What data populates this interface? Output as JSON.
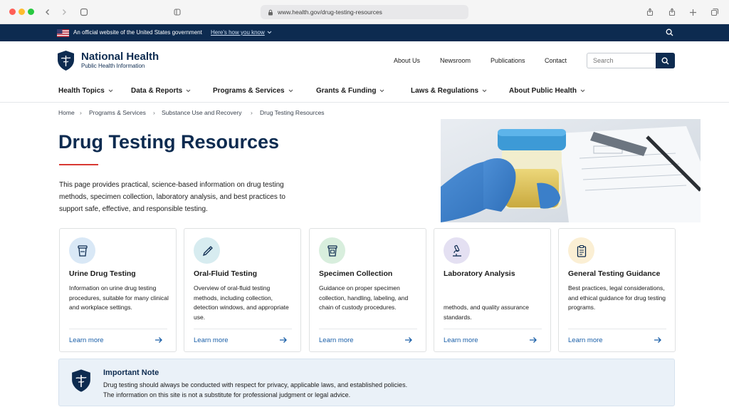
{
  "browser": {
    "url": "www.health.gov/drug-testing-resources"
  },
  "gov_banner": {
    "official_text": "An official website of the United States government",
    "how_you_know": "Here's how you know"
  },
  "header": {
    "site_name": "National Health",
    "site_tagline": "Public Health Information",
    "utility_nav": [
      "About Us",
      "Newsroom",
      "Publications",
      "Contact"
    ],
    "search_placeholder": "Search"
  },
  "main_nav": [
    "Health Topics",
    "Data & Reports",
    "Programs & Services",
    "Grants & Funding",
    "Laws & Regulations",
    "About Public Health"
  ],
  "breadcrumb": [
    "Home",
    "Programs & Services",
    "Substance Use and Recovery",
    "Drug Testing Resources"
  ],
  "hero": {
    "title": "Drug Testing Resources",
    "intro": "This page provides practical, science-based information on drug testing methods, specimen collection, laboratory analysis, and best practices to support safe, effective, and responsible testing."
  },
  "cards": [
    {
      "title": "Urine Drug Testing",
      "description": "Information on urine drug testing procedures, suitable for many clinical and workplace settings.",
      "link": "Learn more",
      "icon": "specimen-cup-icon",
      "icon_bg": "#d9e8f6"
    },
    {
      "title": "Oral-Fluid Testing",
      "description": "Overview of oral-fluid testing methods, including collection, detection windows, and appropriate use.",
      "link": "Learn more",
      "icon": "swab-icon",
      "icon_bg": "#d7ecf0"
    },
    {
      "title": "Specimen Collection",
      "description": "Guidance on proper specimen collection, handling, labeling, and chain of custody procedures.",
      "link": "Learn more",
      "icon": "container-icon",
      "icon_bg": "#d8eedd"
    },
    {
      "title": "Laboratory Analysis",
      "description": "methods, and quality assurance standards.",
      "link": "Learn more",
      "icon": "microscope-icon",
      "icon_bg": "#e4e0f2"
    },
    {
      "title": "General Testing Guidance",
      "description": "Best practices, legal considerations, and ethical guidance for drug testing programs.",
      "link": "Learn more",
      "icon": "clipboard-icon",
      "icon_bg": "#fbefd4"
    }
  ],
  "note": {
    "title": "Important Note",
    "line1": "Drug testing should always be conducted with respect for privacy, applicable laws, and established policies.",
    "line2": "The information on this site is not a substitute for professional judgment or legal advice."
  },
  "colors": {
    "navy": "#0d2b50",
    "accent_red": "#d83933",
    "link_blue": "#1a5fa8"
  }
}
